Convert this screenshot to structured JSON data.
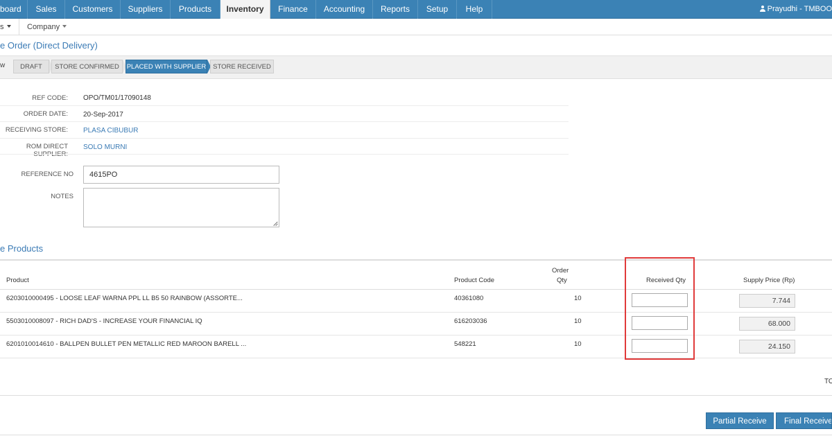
{
  "topnav": {
    "items": [
      "board",
      "Sales",
      "Customers",
      "Suppliers",
      "Products",
      "Inventory",
      "Finance",
      "Accounting",
      "Reports",
      "Setup",
      "Help"
    ],
    "active": "Inventory",
    "user": "Prayudhi - TMBOO"
  },
  "subnav": {
    "item1": "s",
    "item2": "Company"
  },
  "page_title": "e Order (Direct Delivery)",
  "workflow": {
    "label": "w",
    "steps": [
      "DRAFT",
      "STORE CONFIRMED",
      "PLACED WITH SUPPLIER",
      "STORE RECEIVED"
    ],
    "active_step": "PLACED WITH SUPPLIER"
  },
  "info": {
    "ref_code_label": "REF CODE:",
    "ref_code": "OPO/TM01/17090148",
    "order_date_label": "ORDER DATE:",
    "order_date": "20-Sep-2017",
    "receiving_store_label": "RECEIVING STORE:",
    "receiving_store": "PLASA CIBUBUR",
    "supplier_label": "ROM DIRECT SUPPLIER:",
    "supplier": "SOLO MURNI"
  },
  "form": {
    "reference_no_label": "REFERENCE NO",
    "reference_no": "4615PO",
    "notes_label": "NOTES",
    "notes": ""
  },
  "products_section_title": "e Products",
  "table": {
    "headers": {
      "product": "Product",
      "product_code": "Product Code",
      "order_qty_1": "Order",
      "order_qty_2": "Qty",
      "received_qty": "Received Qty",
      "supply_price": "Supply Price (Rp)"
    },
    "rows": [
      {
        "product": "6203010000495  -  LOOSE LEAF WARNA PPL LL B5 50 RAINBOW (ASSORTE...",
        "code": "40361080",
        "order_qty": "10",
        "received_qty": "",
        "price": "7.744"
      },
      {
        "product": "5503010008097  -  RICH DAD'S - INCREASE YOUR FINANCIAL IQ",
        "code": "616203036",
        "order_qty": "10",
        "received_qty": "",
        "price": "68.000"
      },
      {
        "product": "6201010014610  -  BALLPEN BULLET PEN METALLIC RED MAROON BARELL ...",
        "code": "548221",
        "order_qty": "10",
        "received_qty": "",
        "price": "24.150"
      }
    ]
  },
  "total_label": "TO",
  "buttons": {
    "partial": "Partial Receive",
    "final": "Final Receive"
  },
  "colors": {
    "nav_blue": "#3b82b5",
    "link_blue": "#3b7bb5",
    "highlight_red": "#e03a3a"
  }
}
